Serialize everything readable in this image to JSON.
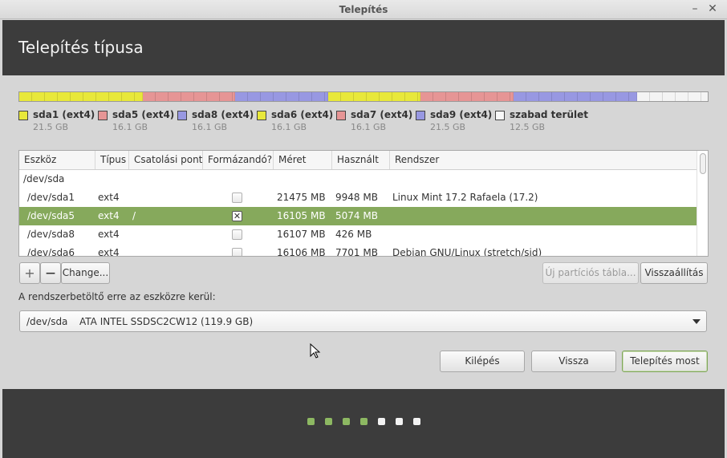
{
  "window": {
    "title": "Telepítés",
    "minimize_glyph": "–",
    "close_glyph": "✕"
  },
  "header": {
    "title": "Telepítés típusa"
  },
  "partitions_bar": [
    {
      "name": "sda1",
      "color": "#e8e83a",
      "fraction": 0.1795
    },
    {
      "name": "sda5",
      "color": "#e69595",
      "fraction": 0.1345
    },
    {
      "name": "sda8",
      "color": "#9898e2",
      "fraction": 0.1345
    },
    {
      "name": "sda6",
      "color": "#e8e83a",
      "fraction": 0.1345
    },
    {
      "name": "sda7",
      "color": "#e69595",
      "fraction": 0.1345
    },
    {
      "name": "sda9",
      "color": "#9898e2",
      "fraction": 0.1795
    },
    {
      "name": "free",
      "color": "#f4f4f4",
      "fraction": 0.103
    }
  ],
  "legend": [
    {
      "label": "sda1 (ext4)",
      "size": "21.5 GB",
      "color": "#e8e83a"
    },
    {
      "label": "sda5 (ext4)",
      "size": "16.1 GB",
      "color": "#e69595"
    },
    {
      "label": "sda8 (ext4)",
      "size": "16.1 GB",
      "color": "#9898e2"
    },
    {
      "label": "sda6 (ext4)",
      "size": "16.1 GB",
      "color": "#e8e83a"
    },
    {
      "label": "sda7 (ext4)",
      "size": "16.1 GB",
      "color": "#e69595"
    },
    {
      "label": "sda9 (ext4)",
      "size": "21.5 GB",
      "color": "#9898e2"
    },
    {
      "label": "szabad terület",
      "size": "12.5 GB",
      "color": "#f8f8f8"
    }
  ],
  "table": {
    "headers": [
      "Eszköz",
      "Típus",
      "Csatolási pont",
      "Formázandó?",
      "Méret",
      "Használt",
      "Rendszer"
    ],
    "group": "/dev/sda",
    "rows": [
      {
        "device": "/dev/sda1",
        "type": "ext4",
        "mount": "",
        "format": false,
        "size": "21475 MB",
        "used": "9948 MB",
        "system": "Linux Mint 17.2 Rafaela (17.2)",
        "selected": false
      },
      {
        "device": "/dev/sda5",
        "type": "ext4",
        "mount": "/",
        "format": true,
        "size": "16105 MB",
        "used": "5074 MB",
        "system": "",
        "selected": true
      },
      {
        "device": "/dev/sda8",
        "type": "ext4",
        "mount": "",
        "format": false,
        "size": "16107 MB",
        "used": "426 MB",
        "system": "",
        "selected": false
      },
      {
        "device": "/dev/sda6",
        "type": "ext4",
        "mount": "",
        "format": false,
        "size": "16106 MB",
        "used": "7701 MB",
        "system": "Debian GNU/Linux (stretch/sid)",
        "selected": false
      }
    ]
  },
  "toolbar": {
    "add": "+",
    "remove": "—",
    "change": "Change...",
    "new_table": "Új partíciós tábla...",
    "revert": "Visszaállítás"
  },
  "bootloader": {
    "label": "A rendszerbetöltő erre az eszközre kerül:",
    "device": "/dev/sda",
    "description": "ATA INTEL SSDSC2CW12 (119.9 GB)"
  },
  "actions": {
    "quit": "Kilépés",
    "back": "Vissza",
    "install": "Telepítés most"
  },
  "progress": {
    "total_steps": 7,
    "completed_steps": 4,
    "done_color": "#8db862",
    "todo_color": "#f2f2f2"
  }
}
